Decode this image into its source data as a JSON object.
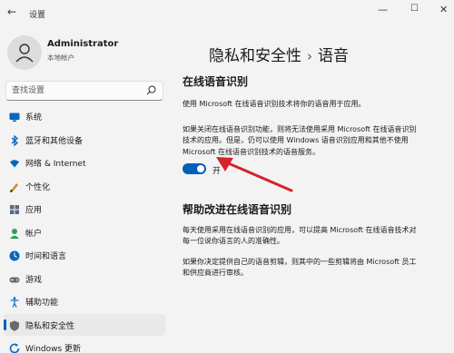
{
  "window": {
    "back_glyph": "←",
    "title": "设置",
    "controls": {
      "minimize": "—",
      "maximize": "☐",
      "close": "✕"
    }
  },
  "user": {
    "name": "Administrator",
    "subtitle": "本地帐户"
  },
  "search": {
    "placeholder": "查找设置"
  },
  "nav": [
    {
      "label": "系统",
      "icon": "monitor-icon",
      "color": "#0067c0"
    },
    {
      "label": "蓝牙和其他设备",
      "icon": "bluetooth-icon",
      "color": "#0067c0"
    },
    {
      "label": "网络 & Internet",
      "icon": "wifi-icon",
      "color": "#0067c0"
    },
    {
      "label": "个性化",
      "icon": "brush-icon",
      "color": "#d08a2e"
    },
    {
      "label": "应用",
      "icon": "apps-icon",
      "color": "#5a6a80"
    },
    {
      "label": "帐户",
      "icon": "account-icon",
      "color": "#2f9c5a"
    },
    {
      "label": "时间和语言",
      "icon": "globe-clock-icon",
      "color": "#0067c0"
    },
    {
      "label": "游戏",
      "icon": "gamepad-icon",
      "color": "#6a6a6a"
    },
    {
      "label": "辅助功能",
      "icon": "accessibility-icon",
      "color": "#1a73c8"
    },
    {
      "label": "隐私和安全性",
      "icon": "shield-icon",
      "color": "#6a6a6a",
      "active": true
    },
    {
      "label": "Windows 更新",
      "icon": "update-icon",
      "color": "#0067c0"
    }
  ],
  "breadcrumb": {
    "parent": "隐私和安全性",
    "separator": "›",
    "current": "语音"
  },
  "online_speech": {
    "title": "在线语音识别",
    "desc": "使用 Microsoft 在线语音识别技术将你的语音用于应用。",
    "warning_lines": [
      "如果关闭在线语音识别功能，则将无法使用采用 Microsoft 在线语音识别",
      "技术的应用。但是，仍可以使用 Windows 语音识别应用和其他不使用",
      "Microsoft 在线语音识别技术的语音服务。"
    ],
    "toggle_state": "开"
  },
  "help_improve": {
    "title": "帮助改进在线语音识别",
    "para1_lines": [
      "每天使用采用在线语音识别的应用，可以提高 Microsoft 在线语音技术对",
      "每一位说你语言的人的准确性。"
    ],
    "para2_lines": [
      "如果你决定提供自己的语音剪辑，则其中的一些剪辑将由 Microsoft 员工",
      "和供应商进行审核。"
    ]
  },
  "annotation_color": "#d4232a"
}
